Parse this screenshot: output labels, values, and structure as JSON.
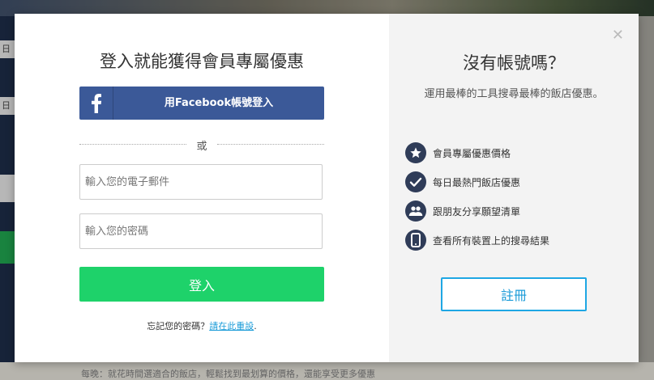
{
  "background": {
    "left_strip_labels": [
      "日",
      "日"
    ],
    "bottom_text": "每晚：就花時間選適合的飯店，輕鬆找到最划算的價格，還能享受更多優惠"
  },
  "login": {
    "title": "登入就能獲得會員專屬優惠",
    "facebook_label": "用Facebook帳號登入",
    "or_text": "或",
    "email_placeholder": "輸入您的電子郵件",
    "password_placeholder": "輸入您的密碼",
    "login_button": "登入",
    "forgot_text": "忘記您的密碼？",
    "reset_link": "請在此重設",
    "period": "."
  },
  "signup": {
    "close_glyph": "✕",
    "title": "沒有帳號嗎？",
    "subtitle": "運用最棒的工具搜尋最棒的飯店優惠。",
    "benefits": [
      {
        "icon": "star-icon",
        "label": "會員專屬優惠價格"
      },
      {
        "icon": "check-icon",
        "label": "每日最熱門飯店優惠"
      },
      {
        "icon": "people-icon",
        "label": "跟朋友分享願望清單"
      },
      {
        "icon": "mobile-icon",
        "label": "查看所有裝置上的搜尋結果"
      }
    ],
    "register_button": "註冊"
  },
  "colors": {
    "facebook": "#3b5998",
    "login_green": "#1ed26a",
    "link_blue": "#1a9bd8",
    "icon_navy": "#2f3c58"
  }
}
